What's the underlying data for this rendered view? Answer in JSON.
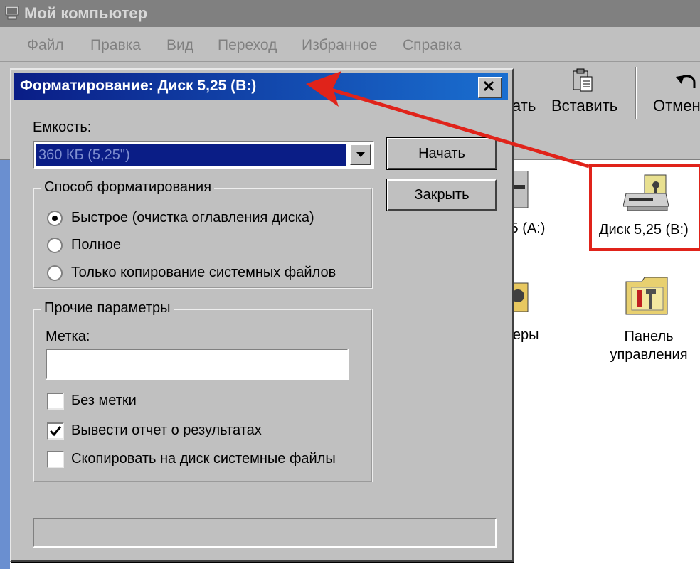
{
  "window": {
    "title": "Мой компьютер",
    "menu": [
      "Файл",
      "Правка",
      "Вид",
      "Переход",
      "Избранное",
      "Справка"
    ],
    "toolbar": {
      "copy_partial": "ать",
      "paste": "Вставить",
      "undo_partial": "Отмен"
    }
  },
  "content": {
    "items": [
      {
        "label": ",5 (A:)"
      },
      {
        "label": "Диск 5,25 (B:)"
      },
      {
        "label": "теры"
      },
      {
        "label": "Панель управления"
      }
    ]
  },
  "dialog": {
    "title": "Форматирование: Диск 5,25 (B:)",
    "capacity_label": "Емкость:",
    "capacity_value": "360 КБ (5,25\")",
    "start_button": "Начать",
    "close_button": "Закрыть",
    "format_group": {
      "title": "Способ форматирования",
      "options": [
        {
          "label": "Быстрое (очистка оглавления диска)",
          "selected": true
        },
        {
          "label": "Полное",
          "selected": false
        },
        {
          "label": "Только копирование системных файлов",
          "selected": false
        }
      ]
    },
    "other_group": {
      "title": "Прочие параметры",
      "label_field_label": "Метка:",
      "label_value": "",
      "checkboxes": [
        {
          "label": "Без метки",
          "checked": false
        },
        {
          "label": "Вывести отчет о результатах",
          "checked": true
        },
        {
          "label": "Скопировать на диск системные файлы",
          "checked": false
        }
      ]
    }
  },
  "colors": {
    "dialog_title_start": "#0a1d86",
    "dialog_title_end": "#1a6fd0",
    "highlight": "#e0231a",
    "face": "#c0c0c0"
  }
}
